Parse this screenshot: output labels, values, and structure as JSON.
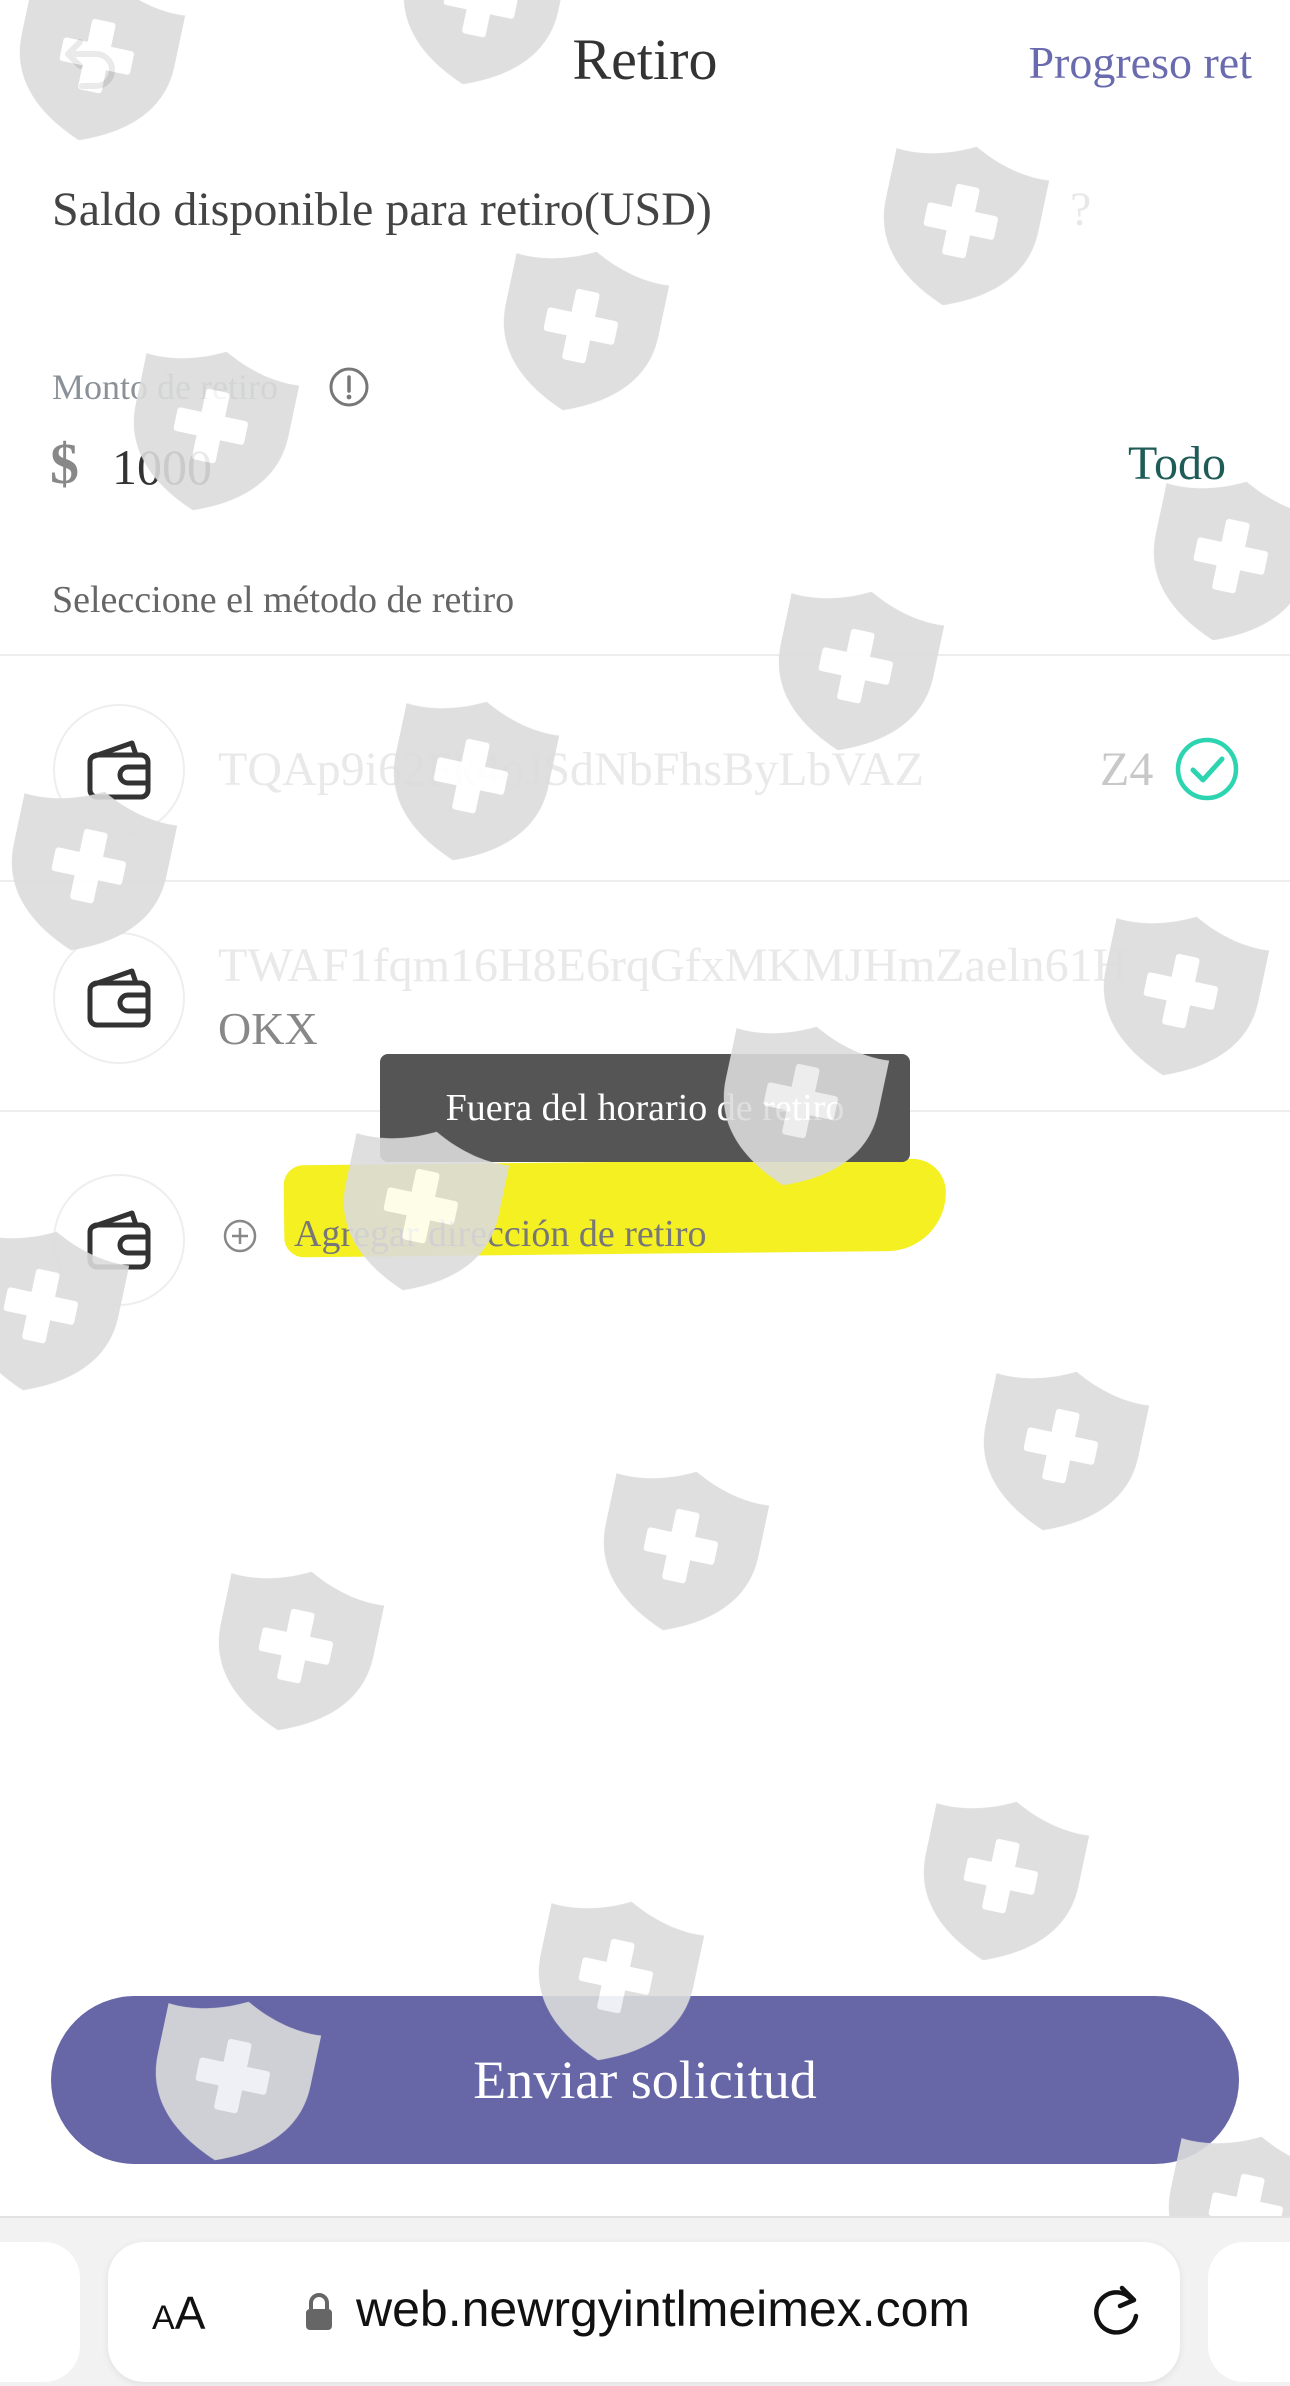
{
  "header": {
    "title": "Retiro",
    "progress_link": "Progreso ret"
  },
  "balance": {
    "label": "Saldo disponible para retiro(USD)",
    "value": "?"
  },
  "amount": {
    "label": "Monto de retiro",
    "currency_symbol": "$",
    "value": "1000",
    "all_label": "Todo"
  },
  "methods": {
    "label": "Seleccione el método de retiro",
    "items": [
      {
        "address_faded": "TQAp9i62Fk4oJSdNbFhsByLbVAZ",
        "address_suffix": "Z4",
        "selected": true
      },
      {
        "address_faded": "TWAF1fqm16H8E6rqGfxMKMJHmZaeln61H",
        "exchange": "OKX",
        "selected": false
      }
    ],
    "add_label": "Agregar dirección de retiro"
  },
  "toast": {
    "message": "Fuera del horario de retiro"
  },
  "submit": {
    "label": "Enviar solicitud"
  },
  "browser": {
    "aa_small": "A",
    "aa_big": "A",
    "url": "web.newrgyintlmeimex.com"
  },
  "colors": {
    "accent": "#6767a7",
    "link": "#6a6aaf",
    "todo": "#1f5c58",
    "check": "#2dd4b0",
    "highlight": "#f4ef16",
    "toast_bg": "#555555",
    "watermark": "#dcdcdc"
  },
  "icons": {
    "back": "back-arrow-icon",
    "info": "info-circle-icon",
    "wallet": "wallet-icon",
    "check": "check-circle-icon",
    "add": "plus-circle-icon",
    "lock": "lock-icon",
    "reload": "reload-icon",
    "watermark": "shield-cross-icon"
  }
}
